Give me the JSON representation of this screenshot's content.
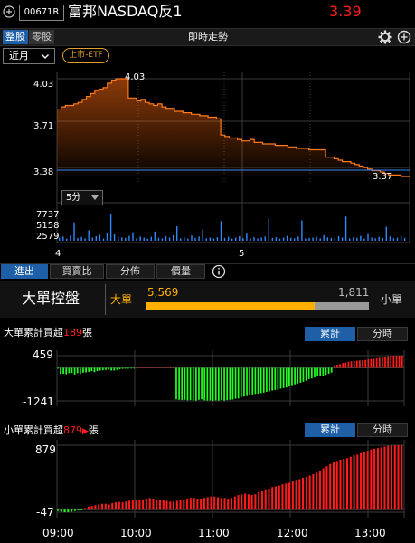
{
  "colors": {
    "red": "#ff1c1c",
    "green": "#22ff22",
    "orange": "#ff7a1c",
    "blue": "#2f89ff",
    "yellow": "#ffb000",
    "gold": "#e0a030",
    "accent_blue": "#1e5fa8"
  },
  "header": {
    "add_icon": "plus-circle-icon",
    "code": "00671R",
    "name": "富邦NASDAQ反1",
    "price": "3.39"
  },
  "toolbar": {
    "tab_whole": "整股",
    "tab_odd": "零股",
    "title": "即時走勢",
    "settings_icon": "gear-icon",
    "add_icon": "plus-circle-icon"
  },
  "filter": {
    "period": "近月",
    "badge": "上市-ETF"
  },
  "price_chart": {
    "y_ticks": [
      "4.03",
      "3.71",
      "3.38"
    ],
    "high_label": "4.03",
    "low_label": "3.37",
    "interval": "5分",
    "vol_ticks": [
      "7737",
      "5158",
      "2579"
    ],
    "x_ticks": [
      "4",
      "5"
    ]
  },
  "tabs": {
    "items": [
      "進出",
      "買賣比",
      "分佈",
      "價量"
    ],
    "info_icon": "info-icon"
  },
  "control": {
    "title": "大單控盤",
    "big_label": "大單",
    "big_value": "5,569",
    "small_value": "1,811",
    "small_label": "小單",
    "big_ratio": 0.755
  },
  "big_cum": {
    "title_prefix": "大單累計買超",
    "title_value": "189",
    "title_suffix": "張",
    "btn_cum": "累計",
    "btn_time": "分時",
    "y_top": "459",
    "y_bottom": "-1241"
  },
  "small_cum": {
    "title_prefix": "小單累計買超",
    "title_value": "879",
    "title_suffix": "張",
    "btn_cum": "累計",
    "btn_time": "分時",
    "y_top": "879",
    "y_bottom": "-47"
  },
  "time_axis": [
    "09:00",
    "10:00",
    "11:00",
    "12:00",
    "13:00"
  ],
  "chart_data": [
    {
      "type": "line",
      "ylim": [
        3.37,
        4.03
      ],
      "x_ticks": [
        "4",
        "5"
      ],
      "y_ticks": [
        4.03,
        3.71,
        3.38
      ],
      "series": [
        {
          "values": [
            3.82,
            3.84,
            3.85,
            3.85,
            3.86,
            3.87,
            3.89,
            3.91,
            3.93,
            3.95,
            3.96,
            3.97,
            4.0,
            4.02,
            4.03,
            4.03,
            4.03,
            3.9,
            3.9,
            3.88,
            3.89,
            3.87,
            3.86,
            3.85,
            3.86,
            3.84,
            3.83,
            3.83,
            3.81,
            3.81,
            3.8,
            3.8,
            3.79,
            3.79,
            3.78,
            3.78,
            3.77,
            3.77,
            3.76,
            3.65,
            3.64,
            3.63,
            3.63,
            3.62,
            3.61,
            3.61,
            3.62,
            3.6,
            3.6,
            3.59,
            3.59,
            3.59,
            3.58,
            3.58,
            3.58,
            3.57,
            3.57,
            3.56,
            3.56,
            3.56,
            3.55,
            3.55,
            3.55,
            3.55,
            3.5,
            3.5,
            3.49,
            3.48,
            3.47,
            3.47,
            3.46,
            3.45,
            3.44,
            3.43,
            3.42,
            3.41,
            3.41,
            3.4,
            3.39,
            3.38,
            3.38,
            3.38,
            3.37,
            3.37,
            3.37
          ]
        }
      ]
    },
    {
      "type": "bar",
      "ylim": [
        0,
        7737
      ],
      "y_ticks": [
        7737,
        5158,
        2579
      ],
      "series": [
        {
          "values": [
            900,
            1200,
            600,
            1500,
            5200,
            800,
            1100,
            700,
            3000,
            900,
            1300,
            1700,
            650,
            2200,
            7737,
            1800,
            1100,
            950,
            800,
            1400,
            2400,
            700,
            1200,
            900,
            600,
            1100,
            2600,
            850,
            700,
            1300,
            900,
            1600,
            4100,
            700,
            950,
            600,
            1500,
            800,
            1200,
            3300,
            700,
            900,
            650,
            1000,
            5600,
            800,
            1100,
            600,
            900,
            1300,
            750,
            2000,
            700,
            1000,
            650,
            900,
            1200,
            6300,
            800,
            1000,
            600,
            900,
            1400,
            850,
            700,
            1200,
            5800,
            650,
            800,
            900,
            1100,
            700,
            1600,
            950,
            800,
            700,
            1300,
            900,
            6900,
            700,
            1000,
            850,
            1400,
            600,
            1900,
            900,
            700,
            1100,
            800,
            4000,
            1200,
            700,
            900,
            1500,
            800
          ]
        }
      ]
    },
    {
      "type": "bar",
      "title": "大單累計買超189張",
      "ylim": [
        -1241,
        459
      ],
      "x_ticks": [
        "09:00",
        "10:00",
        "11:00",
        "12:00",
        "13:00"
      ],
      "series": [
        {
          "values": [
            -30,
            -230,
            -220,
            -240,
            -200,
            -190,
            -250,
            -200,
            -230,
            -180,
            -170,
            -150,
            -120,
            -160,
            -120,
            -100,
            -90,
            -80,
            -70,
            -100,
            -100,
            -80,
            -50,
            -40,
            -30,
            -30,
            -20,
            -10,
            0,
            30,
            40,
            40,
            40,
            40,
            30,
            40,
            30,
            30,
            40,
            50,
            60,
            50,
            -1180,
            -1200,
            -1210,
            -1200,
            -1220,
            -1210,
            -1220,
            -1230,
            -1200,
            -1180,
            -1220,
            -1230,
            -1220,
            -1240,
            -1220,
            -1230,
            -1200,
            -1230,
            -1210,
            -1200,
            -1190,
            -1160,
            -1150,
            -1100,
            -1080,
            -1060,
            -1030,
            -1000,
            -980,
            -970,
            -950,
            -930,
            -900,
            -880,
            -850,
            -830,
            -820,
            -780,
            -760,
            -740,
            -700,
            -650,
            -620,
            -600,
            -560,
            -520,
            -480,
            -420,
            -400,
            -360,
            -320,
            -310,
            -300,
            -260,
            -220,
            -180,
            80,
            120,
            140,
            180,
            200,
            230,
            250,
            260,
            270,
            280,
            290,
            300,
            320,
            330,
            340,
            360,
            380,
            400,
            420,
            440,
            450,
            459,
            459,
            459,
            459
          ]
        }
      ]
    },
    {
      "type": "bar",
      "title": "小單累計買超879張",
      "ylim": [
        -47,
        879
      ],
      "x_ticks": [
        "09:00",
        "10:00",
        "11:00",
        "12:00",
        "13:00"
      ],
      "series": [
        {
          "values": [
            -30,
            -40,
            -47,
            -45,
            -40,
            -30,
            -20,
            -10,
            10,
            30,
            40,
            50,
            60,
            70,
            70,
            60,
            80,
            90,
            95,
            90,
            100,
            110,
            120,
            120,
            130,
            130,
            140,
            150,
            140,
            130,
            120,
            120,
            110,
            100,
            100,
            110,
            120,
            130,
            140,
            150,
            150,
            140,
            140,
            150,
            160,
            170,
            170,
            160,
            150,
            150,
            140,
            150,
            170,
            190,
            200,
            210,
            200,
            190,
            200,
            230,
            250,
            270,
            280,
            300,
            310,
            320,
            340,
            350,
            360,
            380,
            400,
            410,
            430,
            440,
            460,
            480,
            500,
            530,
            560,
            590,
            620,
            640,
            660,
            680,
            690,
            700,
            720,
            740,
            750,
            770,
            790,
            800,
            820,
            830,
            840,
            850,
            860,
            870,
            875,
            879,
            879,
            879
          ]
        }
      ]
    }
  ]
}
